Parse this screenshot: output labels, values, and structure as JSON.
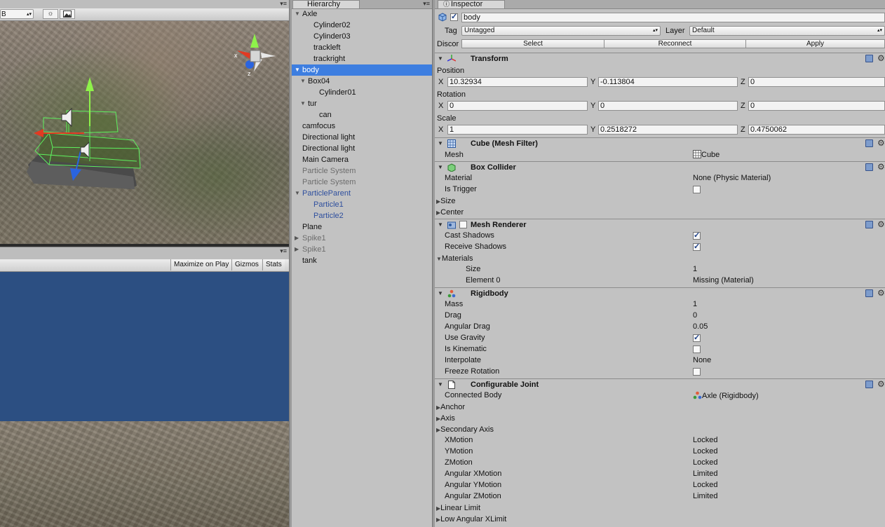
{
  "scene": {
    "draw_mode": "B",
    "gizmo_labels": {
      "x": "x",
      "z": "z"
    }
  },
  "game": {
    "buttons": [
      "Maximize on Play",
      "Gizmos",
      "Stats"
    ]
  },
  "hierarchy": {
    "tab_label": "Hierarchy",
    "items": [
      {
        "label": "Axle",
        "indent": 0,
        "fold": "open"
      },
      {
        "label": "Cylinder02",
        "indent": 2,
        "fold": "none"
      },
      {
        "label": "Cylinder03",
        "indent": 2,
        "fold": "none"
      },
      {
        "label": "trackleft",
        "indent": 2,
        "fold": "none"
      },
      {
        "label": "trackright",
        "indent": 2,
        "fold": "none"
      },
      {
        "label": "body",
        "indent": 0,
        "fold": "open",
        "selected": true
      },
      {
        "label": "Box04",
        "indent": 1,
        "fold": "open"
      },
      {
        "label": "Cylinder01",
        "indent": 3,
        "fold": "none"
      },
      {
        "label": "tur",
        "indent": 1,
        "fold": "open"
      },
      {
        "label": "can",
        "indent": 3,
        "fold": "none"
      },
      {
        "label": "camfocus",
        "indent": 0,
        "fold": "none"
      },
      {
        "label": "Directional light",
        "indent": 0,
        "fold": "none"
      },
      {
        "label": "Directional light",
        "indent": 0,
        "fold": "none"
      },
      {
        "label": "Main Camera",
        "indent": 0,
        "fold": "none"
      },
      {
        "label": "Particle System",
        "indent": 0,
        "fold": "none",
        "style": "dim"
      },
      {
        "label": "Particle System",
        "indent": 0,
        "fold": "none",
        "style": "dim"
      },
      {
        "label": "ParticleParent",
        "indent": 0,
        "fold": "open",
        "style": "prefab"
      },
      {
        "label": "Particle1",
        "indent": 2,
        "fold": "none",
        "style": "prefab"
      },
      {
        "label": "Particle2",
        "indent": 2,
        "fold": "none",
        "style": "prefab"
      },
      {
        "label": "Plane",
        "indent": 0,
        "fold": "none"
      },
      {
        "label": "Spike1",
        "indent": 0,
        "fold": "closed",
        "style": "dim"
      },
      {
        "label": "Spike1",
        "indent": 0,
        "fold": "closed",
        "style": "dim"
      },
      {
        "label": "tank",
        "indent": 0,
        "fold": "none"
      }
    ]
  },
  "inspector": {
    "tab_label": "Inspector",
    "object_name": "body",
    "tag_label": "Tag",
    "tag_value": "Untagged",
    "layer_label": "Layer",
    "layer_value": "Default",
    "prefab_label": "Discor",
    "prefab_buttons": {
      "select": "Select",
      "reconnect": "Reconnect",
      "apply": "Apply"
    },
    "transform": {
      "title": "Transform",
      "position_label": "Position",
      "rotation_label": "Rotation",
      "scale_label": "Scale",
      "axis": {
        "x": "X",
        "y": "Y",
        "z": "Z"
      },
      "position": {
        "x": "10.32934",
        "y": "-0.113804",
        "z": "0"
      },
      "rotation": {
        "x": "0",
        "y": "0",
        "z": "0"
      },
      "scale": {
        "x": "1",
        "y": "0.2518272",
        "z": "0.4750062"
      }
    },
    "mesh_filter": {
      "title": "Cube (Mesh Filter)",
      "mesh_label": "Mesh",
      "mesh_value": "Cube"
    },
    "box_collider": {
      "title": "Box Collider",
      "material_label": "Material",
      "material_value": "None (Physic Material)",
      "is_trigger_label": "Is Trigger",
      "is_trigger": false,
      "size_label": "Size",
      "center_label": "Center"
    },
    "mesh_renderer": {
      "title": "Mesh Renderer",
      "cast_shadows_label": "Cast Shadows",
      "cast_shadows": true,
      "receive_shadows_label": "Receive Shadows",
      "receive_shadows": true,
      "materials_label": "Materials",
      "size_label": "Size",
      "size_value": "1",
      "element0_label": "Element 0",
      "element0_value": "Missing (Material)"
    },
    "rigidbody": {
      "title": "Rigidbody",
      "mass_label": "Mass",
      "mass": "1",
      "drag_label": "Drag",
      "drag": "0",
      "angular_drag_label": "Angular Drag",
      "angular_drag": "0.05",
      "use_gravity_label": "Use Gravity",
      "use_gravity": true,
      "is_kinematic_label": "Is Kinematic",
      "is_kinematic": false,
      "interpolate_label": "Interpolate",
      "interpolate": "None",
      "freeze_rotation_label": "Freeze Rotation",
      "freeze_rotation": false
    },
    "configurable_joint": {
      "title": "Configurable Joint",
      "connected_body_label": "Connected Body",
      "connected_body": "Axle (Rigidbody)",
      "anchor_label": "Anchor",
      "axis_label": "Axis",
      "secondary_axis_label": "Secondary Axis",
      "xmotion_label": "XMotion",
      "xmotion": "Locked",
      "ymotion_label": "YMotion",
      "ymotion": "Locked",
      "zmotion_label": "ZMotion",
      "zmotion": "Locked",
      "ang_xmotion_label": "Angular XMotion",
      "ang_xmotion": "Limited",
      "ang_ymotion_label": "Angular YMotion",
      "ang_ymotion": "Locked",
      "ang_zmotion_label": "Angular ZMotion",
      "ang_zmotion": "Limited",
      "linear_limit_label": "Linear Limit",
      "low_ang_xlimit_label": "Low Angular XLimit"
    }
  }
}
